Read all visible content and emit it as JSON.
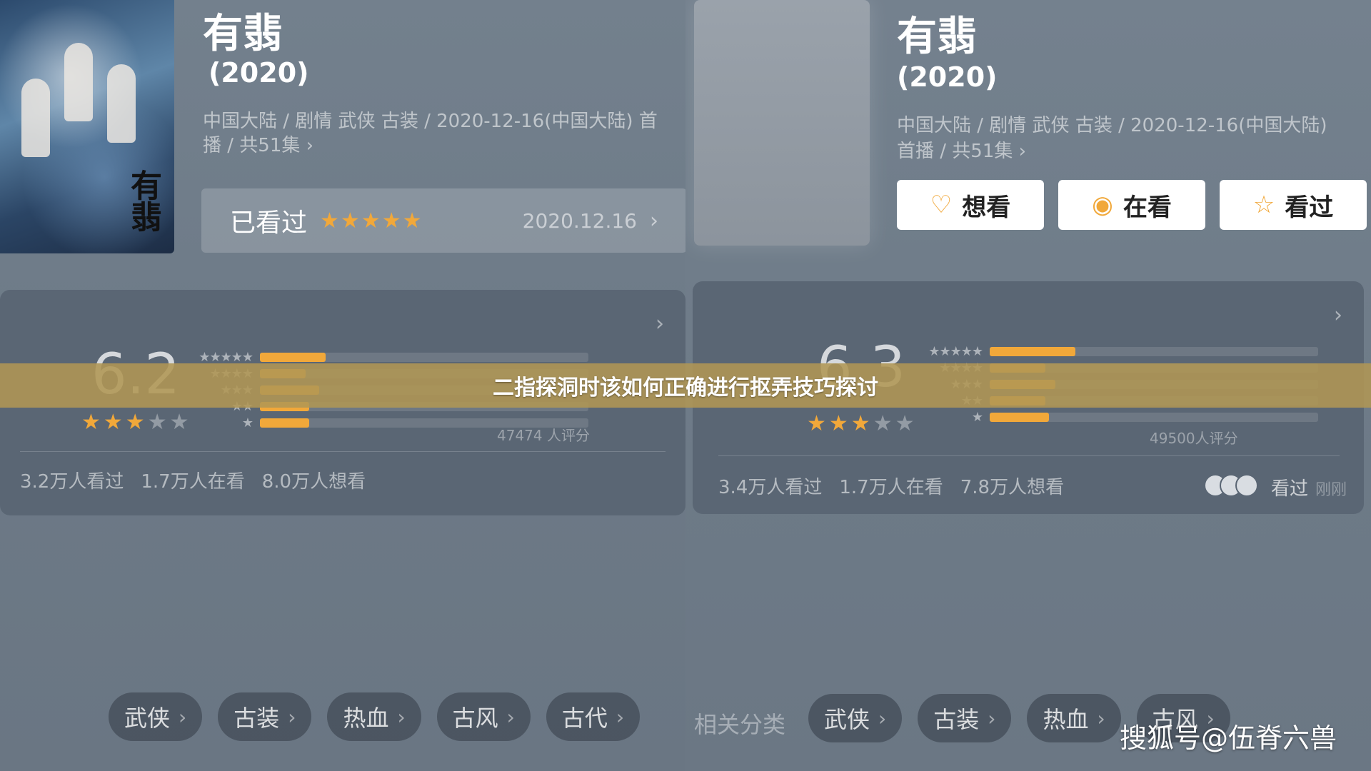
{
  "left": {
    "poster_title": "有翡",
    "title": "有翡",
    "year": "(2020)",
    "meta_line1": "中国大陆 / 剧情 武侠 古装 / 2020-12-16(中国大陆) 首",
    "meta_line2": "播 / 共51集 ›",
    "watched": {
      "label": "已看过",
      "stars": "★★★★★",
      "date": "2020.12.16",
      "chevron": "›"
    },
    "rating": {
      "score": "6.2",
      "score_stars_on": "★★★",
      "score_stars_off": "★★",
      "distribution": [
        {
          "label": "★★★★★",
          "fraction": 0.2
        },
        {
          "label": "★★★★",
          "fraction": 0.14
        },
        {
          "label": "★★★",
          "fraction": 0.18
        },
        {
          "label": "★★",
          "fraction": 0.15
        },
        {
          "label": "★",
          "fraction": 0.15
        }
      ],
      "count": "47474 人评分",
      "stats": [
        "3.2万人看过",
        "1.7万人在看",
        "8.0万人想看"
      ]
    },
    "tags": [
      "武侠",
      "古装",
      "热血",
      "古风",
      "古代"
    ]
  },
  "right": {
    "title": "有翡",
    "year": "(2020)",
    "meta_line1": "中国大陆 / 剧情 武侠 古装 / 2020-12-16(中国大陆)",
    "meta_line2": "首播 / 共51集 ›",
    "actions": [
      {
        "icon": "heart-plus-icon",
        "glyph": "♡",
        "label": "想看"
      },
      {
        "icon": "eye-circle-icon",
        "glyph": "◉",
        "label": "在看"
      },
      {
        "icon": "star-outline-icon",
        "glyph": "☆",
        "label": "看过"
      }
    ],
    "rating": {
      "score": "6.3",
      "score_stars_on": "★★★",
      "score_stars_off": "★★",
      "distribution": [
        {
          "label": "★★★★★",
          "fraction": 0.26
        },
        {
          "label": "★★★★",
          "fraction": 0.17
        },
        {
          "label": "★★★",
          "fraction": 0.2
        },
        {
          "label": "★★",
          "fraction": 0.17
        },
        {
          "label": "★",
          "fraction": 0.18
        }
      ],
      "count": "49500人评分",
      "stats": [
        "3.4万人看过",
        "1.7万人在看",
        "7.8万人想看"
      ],
      "seen_label": "看过",
      "seen_time": "刚刚"
    },
    "related_label": "相关分类",
    "tags": [
      "武侠",
      "古装",
      "热血",
      "古风"
    ]
  },
  "banner": "二指探洞时该如何正确进行抠弄技巧探讨",
  "watermark": "搜狐号@伍脊六兽",
  "colors": {
    "accent": "#f1a83a",
    "banner": "#b09654",
    "card": "#5a6674"
  }
}
